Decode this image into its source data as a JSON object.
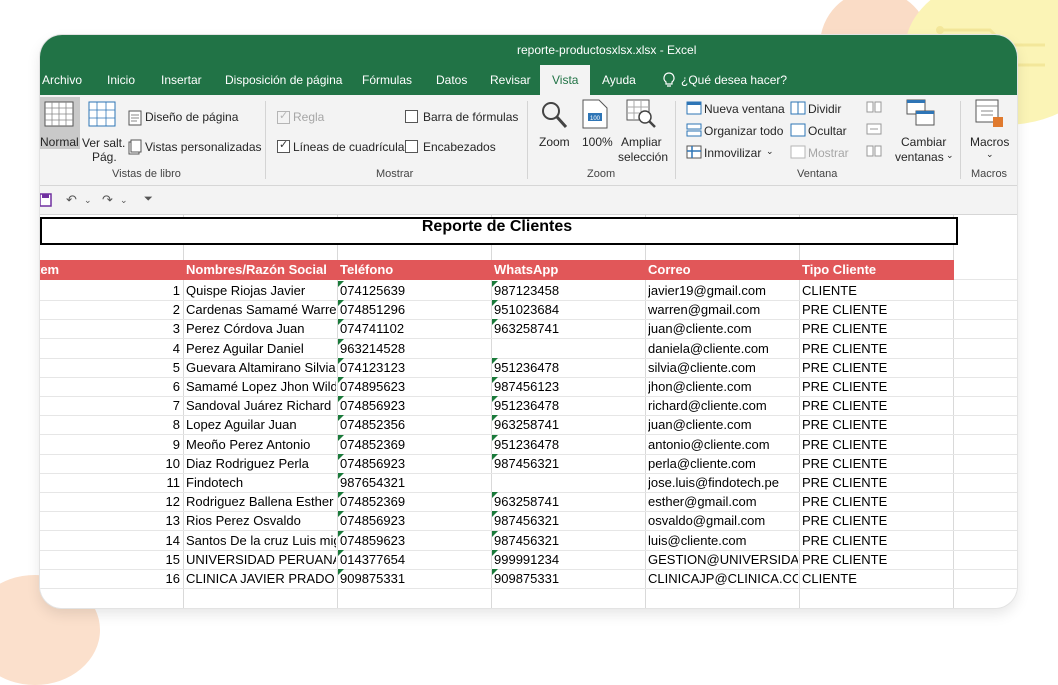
{
  "window": {
    "title": "reporte-productosxlsx.xlsx  -  Excel"
  },
  "menu": {
    "tabs": [
      "Archivo",
      "Inicio",
      "Insertar",
      "Disposición de página",
      "Fórmulas",
      "Datos",
      "Revisar",
      "Vista",
      "Ayuda"
    ],
    "active_tab": "Vista",
    "tell_me": "¿Qué desea hacer?"
  },
  "ribbon": {
    "vistas_libro": {
      "normal": "Normal",
      "ver_salt_1": "Ver salt.",
      "ver_salt_2": "Pág.",
      "diseno": "Diseño de página",
      "personalizadas": "Vistas personalizadas",
      "label": "Vistas de libro"
    },
    "mostrar": {
      "regla": "Regla",
      "barra_formulas": "Barra de fórmulas",
      "lineas": "Líneas de cuadrícula",
      "encabezados": "Encabezados",
      "label": "Mostrar"
    },
    "zoom": {
      "zoom": "Zoom",
      "cien": "100%",
      "ampliar_1": "Ampliar",
      "ampliar_2": "selección",
      "label": "Zoom"
    },
    "ventana": {
      "nueva": "Nueva ventana",
      "organizar": "Organizar todo",
      "inmovilizar": "Inmovilizar",
      "dividir": "Dividir",
      "ocultar": "Ocultar",
      "mostrar": "Mostrar",
      "cambiar_1": "Cambiar",
      "cambiar_2": "ventanas",
      "label": "Ventana"
    },
    "macros": {
      "macros": "Macros",
      "label": "Macros"
    }
  },
  "sheet": {
    "title": "Reporte de Clientes",
    "headers": [
      "tem",
      "Nombres/Razón Social",
      "Teléfono",
      "WhatsApp",
      "Correo",
      "Tipo Cliente"
    ],
    "rows": [
      [
        "1",
        "Quispe Riojas Javier",
        "074125639",
        "987123458",
        "javier19@gmail.com",
        "CLIENTE"
      ],
      [
        "2",
        "Cardenas Samamé Warren",
        "074851296",
        "951023684",
        "warren@gmail.com",
        "PRE CLIENTE"
      ],
      [
        "3",
        "Perez Córdova Juan",
        "074741102",
        "963258741",
        "juan@cliente.com",
        "PRE CLIENTE"
      ],
      [
        "4",
        "Perez Aguilar Daniel",
        "963214528",
        "",
        "daniela@cliente.com",
        "PRE CLIENTE"
      ],
      [
        "5",
        "Guevara Altamirano Silvia",
        "074123123",
        "951236478",
        "silvia@cliente.com",
        "PRE CLIENTE"
      ],
      [
        "6",
        "Samamé Lopez Jhon Wilder",
        "074895623",
        "987456123",
        "jhon@cliente.com",
        "PRE CLIENTE"
      ],
      [
        "7",
        "Sandoval Juárez  Richard",
        "074856923",
        "951236478",
        "richard@cliente.com",
        "PRE CLIENTE"
      ],
      [
        "8",
        "Lopez Aguilar Juan",
        "074852356",
        "963258741",
        "juan@cliente.com",
        "PRE CLIENTE"
      ],
      [
        "9",
        "Meoño Perez Antonio",
        "074852369",
        "951236478",
        "antonio@cliente.com",
        "PRE CLIENTE"
      ],
      [
        "10",
        "Diaz Rodriguez Perla",
        "074856923",
        "987456321",
        "perla@cliente.com",
        "PRE CLIENTE"
      ],
      [
        "11",
        "Findotech",
        "987654321",
        "",
        "jose.luis@findotech.pe",
        "PRE CLIENTE"
      ],
      [
        "12",
        "Rodriguez Ballena Esther",
        "074852369",
        "963258741",
        "esther@gmail.com",
        "PRE CLIENTE"
      ],
      [
        "13",
        "Rios Perez Osvaldo",
        "074856923",
        "987456321",
        "osvaldo@gmail.com",
        "PRE CLIENTE"
      ],
      [
        "14",
        "Santos De la cruz Luis miguel",
        "074859623",
        "987456321",
        "luis@cliente.com",
        "PRE CLIENTE"
      ],
      [
        "15",
        "UNIVERSIDAD PERUANA UNION",
        "014377654",
        "999991234",
        "GESTION@UNIVERSIDADPERUANA.PE",
        "PRE CLIENTE"
      ],
      [
        "16",
        "CLINICA JAVIER PRADO",
        "909875331",
        "909875331",
        "CLINICAJP@CLINICA.COM",
        "CLIENTE"
      ]
    ]
  },
  "colors": {
    "excel_green": "#217346",
    "header_red": "#e15759"
  }
}
